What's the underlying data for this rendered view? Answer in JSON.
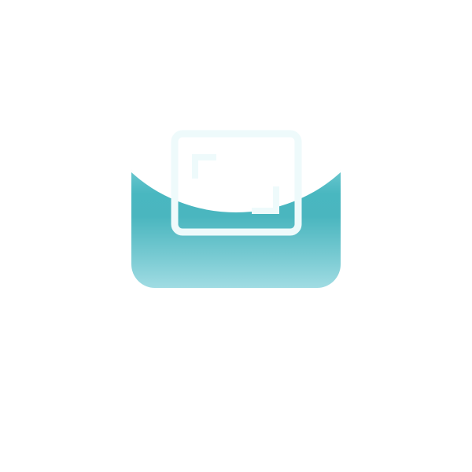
{
  "app_icon": {
    "icon": "fullscreen-frame-icon",
    "colors": {
      "background": "#ffffff",
      "teal_dark": "#49b7c0",
      "teal_light": "#a0dce3",
      "glyph_stroke": "#eefafb"
    }
  }
}
